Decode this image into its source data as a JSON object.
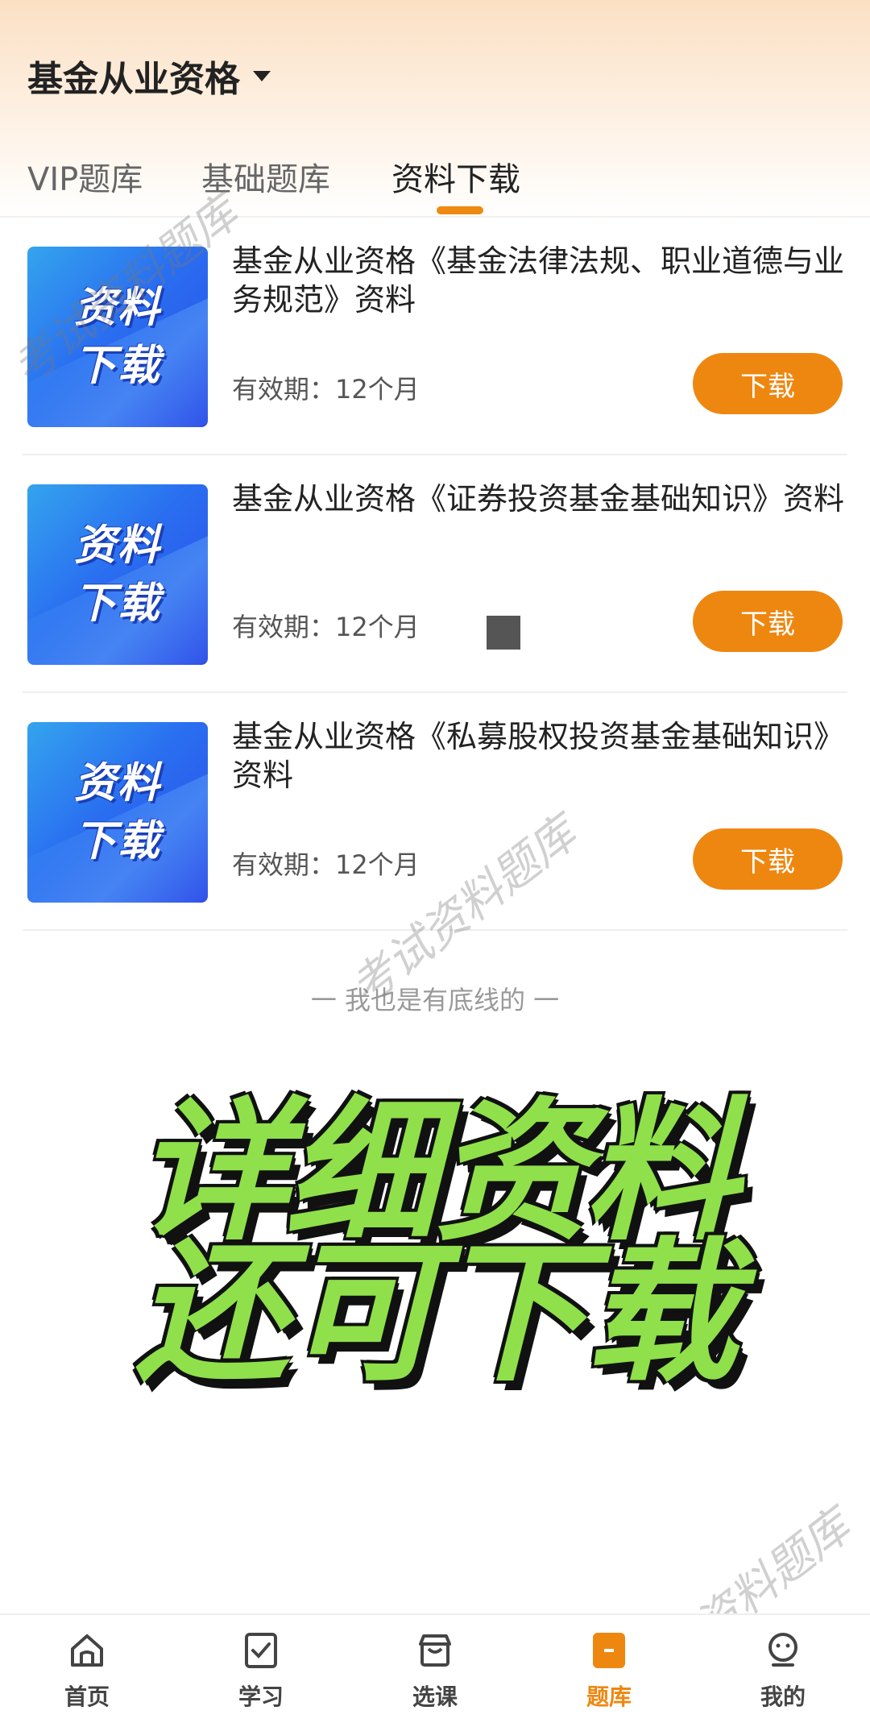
{
  "header": {
    "exam_name": "基金从业资格",
    "tabs": [
      {
        "label": "VIP题库",
        "active": false
      },
      {
        "label": "基础题库",
        "active": false
      },
      {
        "label": "资料下载",
        "active": true
      }
    ]
  },
  "items": [
    {
      "thumb_line1": "资料",
      "thumb_line2": "下载",
      "title": "基金从业资格《基金法律法规、职业道德与业务规范》资料",
      "validity": "有效期：12个月",
      "button": "下载"
    },
    {
      "thumb_line1": "资料",
      "thumb_line2": "下载",
      "title": "基金从业资格《证券投资基金基础知识》资料",
      "validity": "有效期：12个月",
      "button": "下载"
    },
    {
      "thumb_line1": "资料",
      "thumb_line2": "下载",
      "title": "基金从业资格《私募股权投资基金基础知识》资料",
      "validity": "有效期：12个月",
      "button": "下载"
    }
  ],
  "footer_note": "一  我也是有底线的  一",
  "promo": {
    "line1": "详细资料",
    "line2": "还可下载"
  },
  "watermark_text": "考试资料题库",
  "bottom_nav": [
    {
      "label": "首页",
      "icon": "home-icon",
      "active": false
    },
    {
      "label": "学习",
      "icon": "study-icon",
      "active": false
    },
    {
      "label": "选课",
      "icon": "course-icon",
      "active": false
    },
    {
      "label": "题库",
      "icon": "question-bank-icon",
      "active": true
    },
    {
      "label": "我的",
      "icon": "profile-icon",
      "active": false
    }
  ],
  "colors": {
    "accent": "#ee8710",
    "promo_green": "#8fe04a"
  }
}
